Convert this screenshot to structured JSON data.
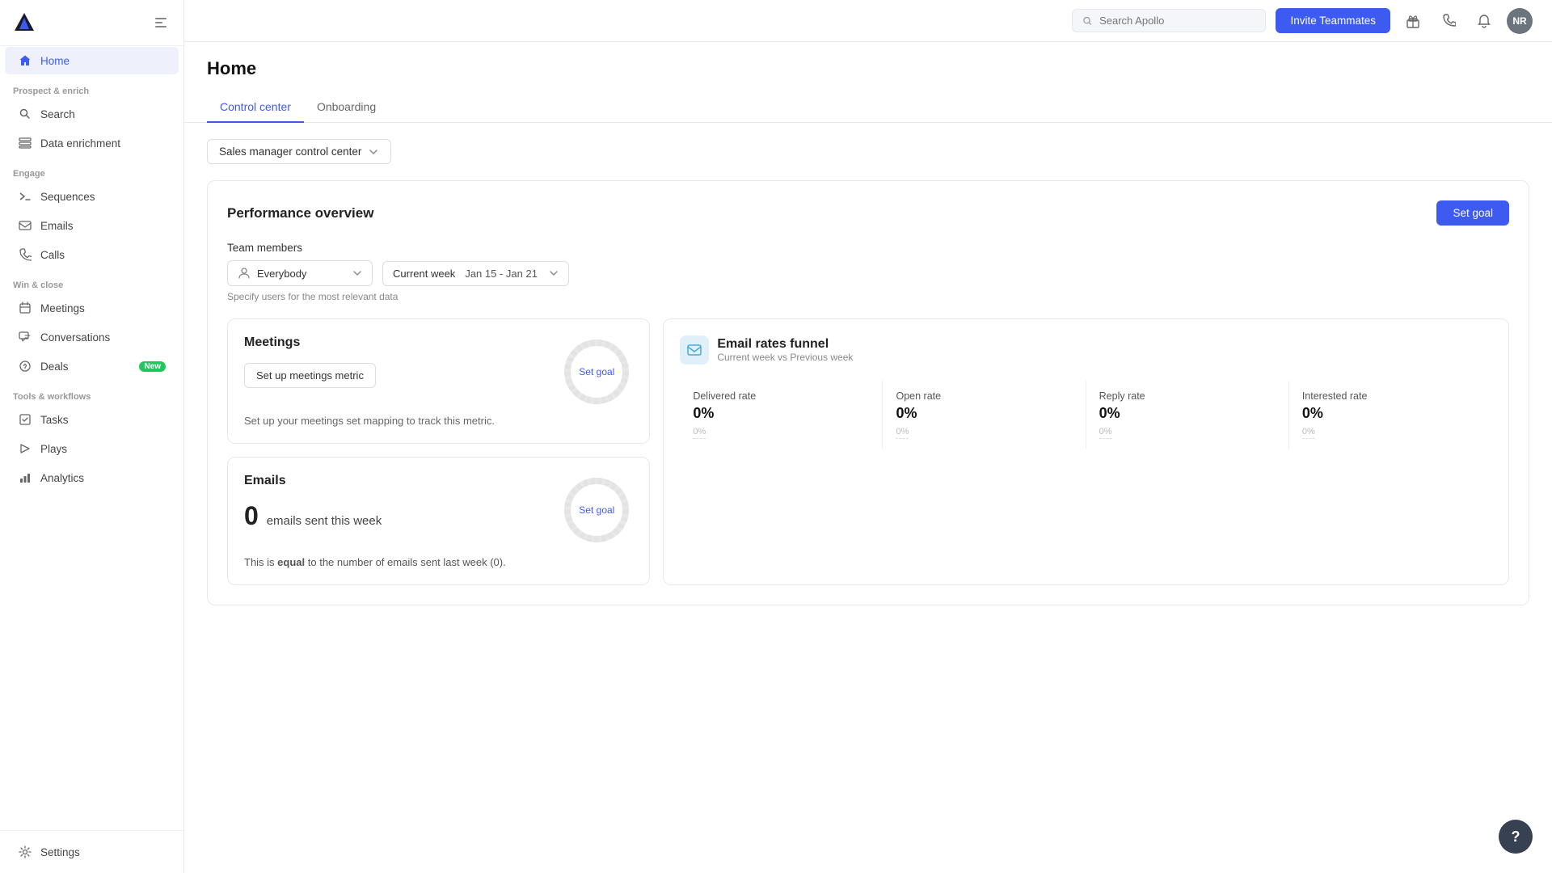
{
  "sidebar": {
    "logo_text": "A",
    "sections": [
      {
        "label": "Prospect & enrich",
        "items": [
          {
            "id": "search",
            "label": "Search",
            "icon": "search"
          },
          {
            "id": "data-enrichment",
            "label": "Data enrichment",
            "icon": "data"
          }
        ]
      },
      {
        "label": "Engage",
        "items": [
          {
            "id": "sequences",
            "label": "Sequences",
            "icon": "sequences"
          },
          {
            "id": "emails",
            "label": "Emails",
            "icon": "emails"
          },
          {
            "id": "calls",
            "label": "Calls",
            "icon": "calls"
          }
        ]
      },
      {
        "label": "Win & close",
        "items": [
          {
            "id": "meetings",
            "label": "Meetings",
            "icon": "meetings"
          },
          {
            "id": "conversations",
            "label": "Conversations",
            "icon": "conversations"
          },
          {
            "id": "deals",
            "label": "Deals",
            "icon": "deals",
            "badge": "New"
          }
        ]
      },
      {
        "label": "Tools & workflows",
        "items": [
          {
            "id": "tasks",
            "label": "Tasks",
            "icon": "tasks"
          },
          {
            "id": "plays",
            "label": "Plays",
            "icon": "plays"
          },
          {
            "id": "analytics",
            "label": "Analytics",
            "icon": "analytics"
          }
        ]
      }
    ],
    "bottom_items": [
      {
        "id": "settings",
        "label": "Settings",
        "icon": "settings"
      }
    ],
    "home_label": "Home"
  },
  "topbar": {
    "search_placeholder": "Search Apollo",
    "invite_label": "Invite Teammates",
    "avatar_initials": "NR"
  },
  "page": {
    "title": "Home",
    "tabs": [
      {
        "id": "control-center",
        "label": "Control center",
        "active": true
      },
      {
        "id": "onboarding",
        "label": "Onboarding",
        "active": false
      }
    ],
    "view_selector": "Sales manager control center",
    "performance": {
      "title": "Performance overview",
      "set_goal_label": "Set goal",
      "team_members_label": "Team members",
      "everybody_label": "Everybody",
      "current_week_label": "Current week",
      "date_range": "Jan 15 - Jan 21",
      "specify_text": "Specify users for the most relevant data",
      "meetings_card": {
        "title": "Meetings",
        "setup_btn_label": "Set up meetings metric",
        "description": "Set up your meetings set mapping to track this metric.",
        "chart_label": "Set goal"
      },
      "emails_card": {
        "title": "Emails",
        "count": "0",
        "count_label": "emails sent this week",
        "comparison": "This is <b>equal</b> to the number of emails sent last week (0).",
        "chart_label": "Set goal"
      },
      "funnel_card": {
        "title": "Email rates funnel",
        "subtitle": "Current week vs Previous week",
        "metrics": [
          {
            "label": "Delivered rate",
            "value": "0%",
            "change": "0%"
          },
          {
            "label": "Open rate",
            "value": "0%",
            "change": "0%"
          },
          {
            "label": "Reply rate",
            "value": "0%",
            "change": "0%"
          },
          {
            "label": "Interested rate",
            "value": "0%",
            "change": "0%"
          }
        ]
      }
    }
  },
  "help": {
    "label": "?"
  }
}
